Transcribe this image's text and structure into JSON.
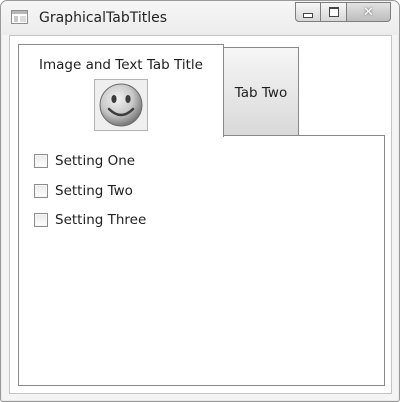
{
  "window": {
    "title": "GraphicalTabTitles",
    "app_icon": "window-icon",
    "caption_buttons": {
      "minimize_icon": "minimize-icon",
      "maximize_icon": "maximize-icon",
      "close_glyph": "✕"
    }
  },
  "tabs": [
    {
      "label": "Image and Text Tab Title",
      "image_icon": "smiley-face-icon",
      "selected": true
    },
    {
      "label": "Tab Two",
      "selected": false
    }
  ],
  "settings": [
    {
      "label": "Setting One",
      "checked": false
    },
    {
      "label": "Setting Two",
      "checked": false
    },
    {
      "label": "Setting Three",
      "checked": false
    }
  ],
  "colors": {
    "window_border": "#9a9a9a",
    "tab_border": "#898989",
    "content_background": "#ffffff"
  }
}
